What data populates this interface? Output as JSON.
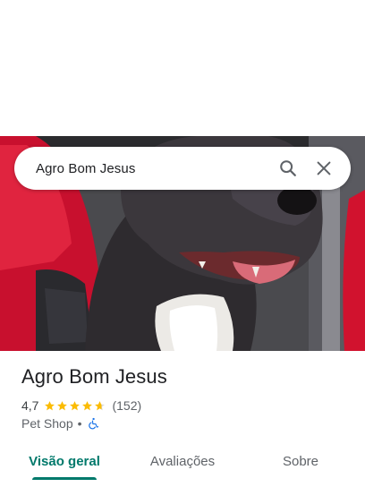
{
  "search": {
    "query": "Agro Bom Jesus",
    "search_icon": "search-icon",
    "close_icon": "close-icon"
  },
  "photo": {
    "subject": "dog-photo"
  },
  "place": {
    "name": "Agro Bom Jesus",
    "rating": "4,7",
    "rating_value": 4.7,
    "reviews": "(152)",
    "category": "Pet Shop",
    "separator": "•",
    "accessibility_icon": "wheelchair-icon"
  },
  "tabs": [
    {
      "label": "Visão geral",
      "active": true
    },
    {
      "label": "Avaliações",
      "active": false
    },
    {
      "label": "Sobre",
      "active": false
    }
  ],
  "colors": {
    "accent": "#00796b",
    "star": "#fbbc04",
    "star_empty": "#dadce0",
    "access_blue": "#1a73e8"
  }
}
